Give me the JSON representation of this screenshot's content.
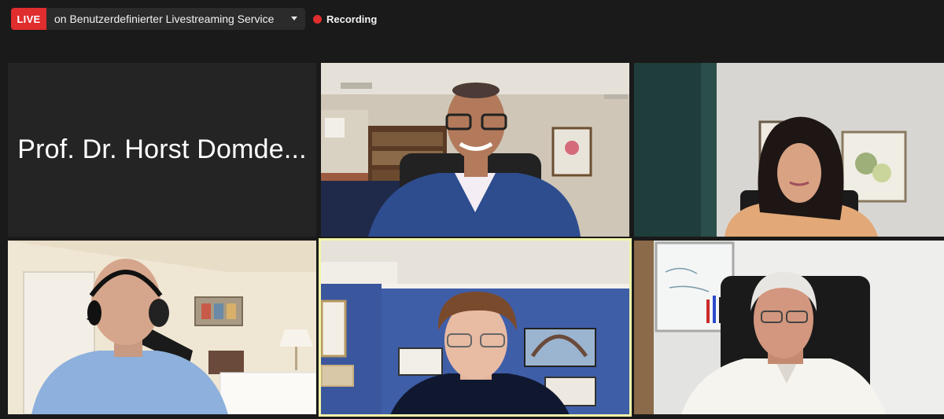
{
  "top_bar": {
    "live_badge": "LIVE",
    "stream_service": "on Benutzerdefinierter Livestreaming Service",
    "recording_label": "Recording",
    "icons": {
      "dropdown": "chevron-down-icon",
      "recording": "recording-dot-icon"
    }
  },
  "gallery": {
    "participants": [
      {
        "name": "Prof. Dr. Horst Domde...",
        "video": false
      },
      {
        "video": true
      },
      {
        "video": true
      },
      {
        "video": true
      },
      {
        "video": true,
        "active_speaker": true
      },
      {
        "video": true
      }
    ]
  },
  "colors": {
    "live_red": "#e02d2d",
    "background": "#1a1a1a",
    "active_speaker_border": "#e7f08a"
  }
}
